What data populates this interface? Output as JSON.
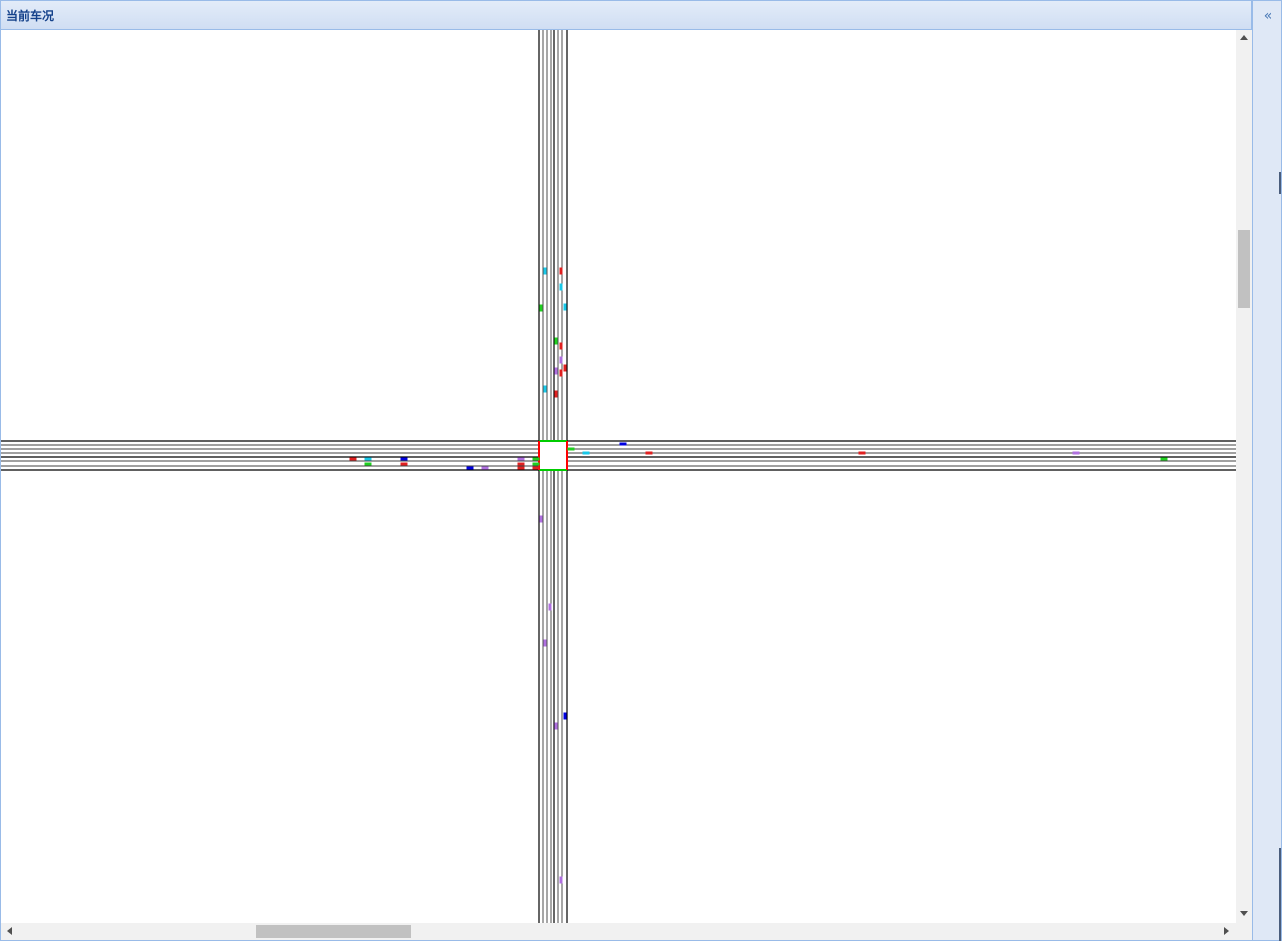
{
  "panel": {
    "title": "当前车况"
  },
  "east_panel": {
    "collapse_icon": "double-chevron-left-icon",
    "collapse_glyph": "«"
  },
  "scrollbars": {
    "vertical": {
      "thumb_start_fraction": 0.215,
      "thumb_length_fraction": 0.09
    },
    "horizontal": {
      "thumb_start_fraction": 0.2,
      "thumb_length_fraction": 0.128
    }
  },
  "map": {
    "road_line_color": "#000000",
    "intersection_stopline_colors": {
      "side": "#ff0000",
      "main": "#00cc00"
    },
    "vehicle_colors": {
      "red": "#e02020",
      "blue": "#0000e0",
      "cyan": "#18c8e8",
      "green": "#20d020",
      "purple": "#b070e0"
    },
    "vehicles": [
      {
        "road": "north",
        "color": "cyan"
      },
      {
        "road": "north",
        "color": "red"
      },
      {
        "road": "north",
        "color": "cyan"
      },
      {
        "road": "north",
        "color": "green"
      },
      {
        "road": "north",
        "color": "cyan"
      },
      {
        "road": "north",
        "color": "green"
      },
      {
        "road": "north",
        "color": "red"
      },
      {
        "road": "north",
        "color": "purple"
      },
      {
        "road": "north",
        "color": "purple"
      },
      {
        "road": "north",
        "color": "red"
      },
      {
        "road": "north",
        "color": "red"
      },
      {
        "road": "north",
        "color": "cyan"
      },
      {
        "road": "north",
        "color": "red"
      },
      {
        "road": "south",
        "color": "purple"
      },
      {
        "road": "south",
        "color": "purple"
      },
      {
        "road": "south",
        "color": "purple"
      },
      {
        "road": "south",
        "color": "blue"
      },
      {
        "road": "south",
        "color": "purple"
      },
      {
        "road": "south",
        "color": "purple"
      },
      {
        "road": "west",
        "color": "red"
      },
      {
        "road": "west",
        "color": "cyan"
      },
      {
        "road": "west",
        "color": "green"
      },
      {
        "road": "west",
        "color": "blue"
      },
      {
        "road": "west",
        "color": "red"
      },
      {
        "road": "west",
        "color": "blue"
      },
      {
        "road": "west",
        "color": "purple"
      },
      {
        "road": "west",
        "color": "purple"
      },
      {
        "road": "west",
        "color": "red"
      },
      {
        "road": "west",
        "color": "red"
      },
      {
        "road": "west",
        "color": "green"
      },
      {
        "road": "west",
        "color": "green"
      },
      {
        "road": "west",
        "color": "red"
      },
      {
        "road": "east",
        "color": "green"
      },
      {
        "road": "east",
        "color": "blue"
      },
      {
        "road": "east",
        "color": "cyan"
      },
      {
        "road": "east",
        "color": "red"
      },
      {
        "road": "east",
        "color": "red"
      },
      {
        "road": "east",
        "color": "purple"
      },
      {
        "road": "east",
        "color": "green"
      }
    ]
  }
}
